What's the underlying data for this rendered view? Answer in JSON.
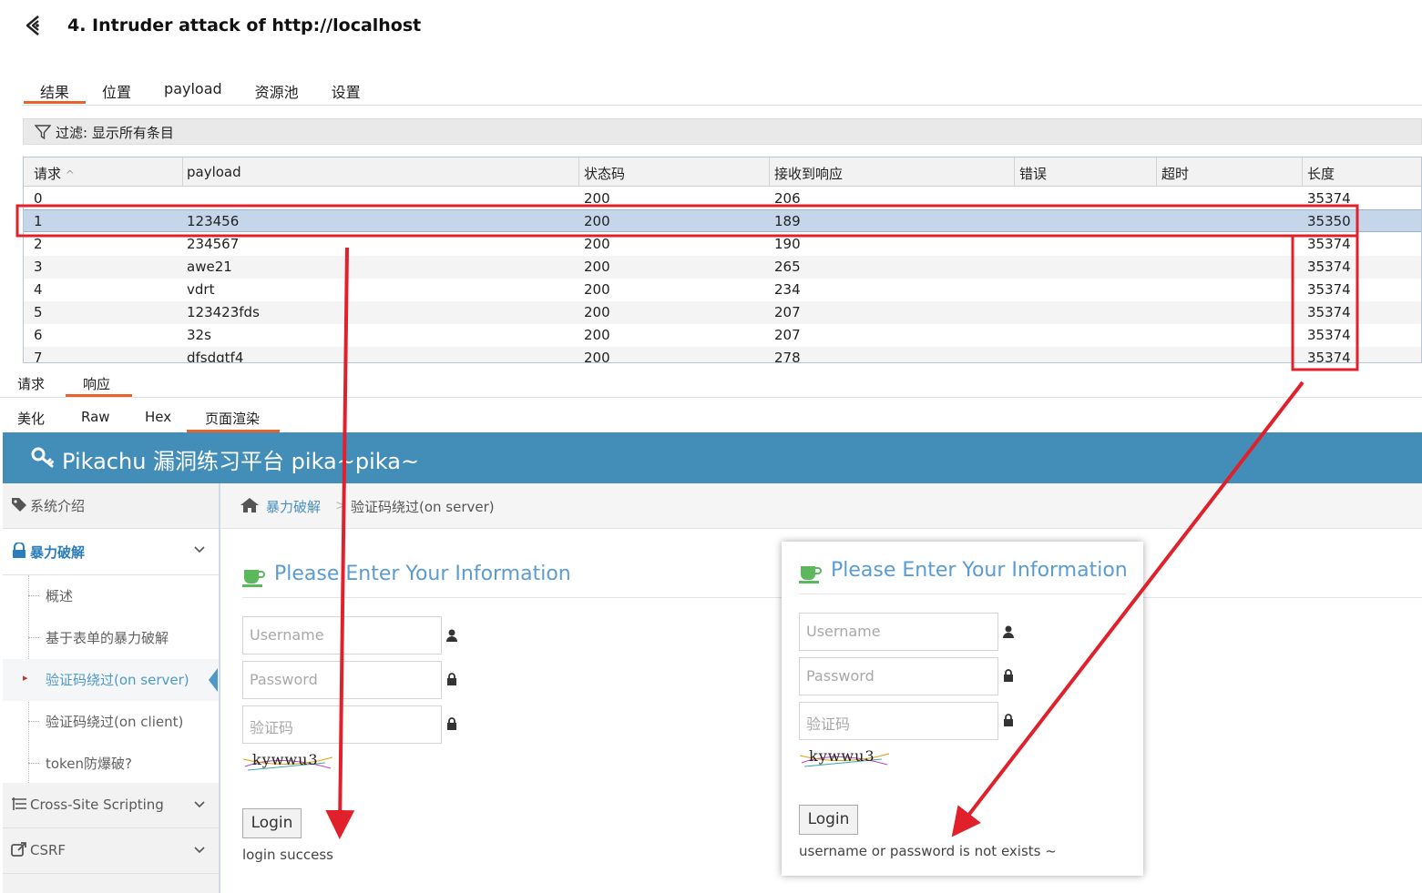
{
  "window": {
    "title": "4. Intruder attack of http://localhost"
  },
  "tabs": [
    "结果",
    "位置",
    "payload",
    "资源池",
    "设置"
  ],
  "filter": {
    "text": "过滤: 显示所有条目"
  },
  "table": {
    "headers": [
      "请求",
      "payload",
      "状态码",
      "接收到响应",
      "错误",
      "超时",
      "长度"
    ],
    "sort_indicator": "^",
    "rows": [
      {
        "request": "0",
        "payload": "",
        "status": "200",
        "response_time": "206",
        "length": "35374"
      },
      {
        "request": "1",
        "payload": "123456",
        "status": "200",
        "response_time": "189",
        "length": "35350"
      },
      {
        "request": "2",
        "payload": "234567",
        "status": "200",
        "response_time": "190",
        "length": "35374"
      },
      {
        "request": "3",
        "payload": "awe21",
        "status": "200",
        "response_time": "265",
        "length": "35374"
      },
      {
        "request": "4",
        "payload": "vdrt",
        "status": "200",
        "response_time": "234",
        "length": "35374"
      },
      {
        "request": "5",
        "payload": "123423fds",
        "status": "200",
        "response_time": "207",
        "length": "35374"
      },
      {
        "request": "6",
        "payload": "32s",
        "status": "200",
        "response_time": "207",
        "length": "35374"
      },
      {
        "request": "7",
        "payload": "dfsdgtf4",
        "status": "200",
        "response_time": "278",
        "length": "35374"
      }
    ]
  },
  "reqresp_tabs": {
    "request": "请求",
    "response": "响应"
  },
  "view_tabs": [
    "美化",
    "Raw",
    "Hex",
    "页面渲染"
  ],
  "colors": {
    "accent": "#e8622c",
    "header_blue": "#438eb9",
    "selection": "#c5d6ea",
    "annotation_red": "#e0202a"
  },
  "pikachu": {
    "brand": "Pikachu 漏洞练习平台 pika~pika~",
    "sidebar": {
      "items": [
        {
          "label": "系统介绍",
          "icon": "tags-icon"
        },
        {
          "label": "暴力破解",
          "icon": "lock-icon"
        },
        {
          "label": "Cross-Site Scripting",
          "icon": "list-icon"
        },
        {
          "label": "CSRF",
          "icon": "share-icon"
        }
      ],
      "subitems": [
        "概述",
        "基于表单的暴力破解",
        "验证码绕过(on server)",
        "验证码绕过(on client)",
        "token防爆破?"
      ]
    },
    "breadcrumb": {
      "parent": "暴力破解",
      "separator": ">",
      "current": "验证码绕过(on server)"
    },
    "form": {
      "heading": "Please Enter Your Information",
      "username_placeholder": "Username",
      "password_placeholder": "Password",
      "captcha_placeholder": "验证码",
      "captcha_text": "kywwu3",
      "login_label": "Login"
    },
    "left_message": "login success",
    "right_message": "username or password is not exists ~"
  }
}
